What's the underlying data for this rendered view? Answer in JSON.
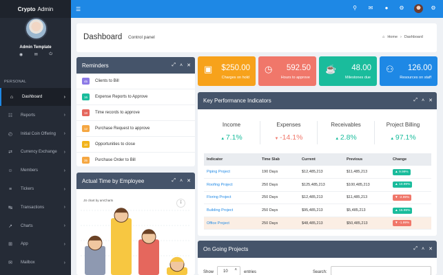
{
  "app": {
    "brand_bold": "Crypto",
    "brand_light": "Admin"
  },
  "user": {
    "name": "Admin Template",
    "icons": [
      "user-icon",
      "mail-icon",
      "power-icon"
    ]
  },
  "sidebar": {
    "section": "PERSONAL",
    "items": [
      {
        "label": "Dashboard",
        "icon": "home-icon",
        "active": true
      },
      {
        "label": "Reports",
        "icon": "reports-icon"
      },
      {
        "label": "Initial Coin Offering",
        "icon": "clock-icon"
      },
      {
        "label": "Currency Exchange",
        "icon": "exchange-icon"
      },
      {
        "label": "Members",
        "icon": "members-icon"
      },
      {
        "label": "Tickers",
        "icon": "sliders-icon"
      },
      {
        "label": "Transactions",
        "icon": "transactions-icon"
      },
      {
        "label": "Charts",
        "icon": "chart-icon"
      },
      {
        "label": "App",
        "icon": "grid-icon"
      },
      {
        "label": "Mailbox",
        "icon": "mailbox-icon"
      }
    ]
  },
  "header": {
    "title": "Dashboard",
    "subtitle": "Control panel",
    "breadcrumb_home": "Home",
    "breadcrumb_current": "Dashboard"
  },
  "reminders": {
    "title": "Reminders",
    "items": [
      {
        "badge": "45",
        "color": "#8c7ae6",
        "label": "Clients to Bill"
      },
      {
        "badge": "16",
        "color": "#1abc9c",
        "label": "Expense Reports to Approve"
      },
      {
        "badge": "18",
        "color": "#e5675d",
        "label": "Time records to approve"
      },
      {
        "badge": "12",
        "color": "#f5a742",
        "label": "Purchase Request to approve"
      },
      {
        "badge": "10",
        "color": "#f2b31a",
        "label": "Opportunities to close"
      },
      {
        "badge": "35",
        "color": "#f5a742",
        "label": "Purchase Order to Bill"
      }
    ]
  },
  "stats": [
    {
      "value": "$250.00",
      "label": "Charges on hold",
      "color": "#f7a21b",
      "icon": "money-icon"
    },
    {
      "value": "592.50",
      "label": "Hours to approve",
      "color": "#f0776a",
      "icon": "clock-icon"
    },
    {
      "value": "48.00",
      "label": "Milestones due",
      "color": "#1abc9c",
      "icon": "trophy-icon"
    },
    {
      "value": "126.00",
      "label": "Resources on staff",
      "color": "#1e88e5",
      "icon": "users-icon"
    }
  ],
  "kpi": {
    "title": "Key Performance Indicators",
    "blocks": [
      {
        "name": "Income",
        "value": "7.1%",
        "dir": "up"
      },
      {
        "name": "Expenses",
        "value": "-14.1%",
        "dir": "down"
      },
      {
        "name": "Receivables",
        "value": "2.8%",
        "dir": "up"
      },
      {
        "name": "Project Billing",
        "value": "97.1%",
        "dir": "up"
      }
    ],
    "columns": [
      "Indicator",
      "Time Slab",
      "Current",
      "Previous",
      "Change"
    ],
    "rows": [
      {
        "indicator": "Piping Project",
        "slab": "190 Days",
        "current": "$12,485,213",
        "previous": "$11,485,213",
        "change": "9.99%",
        "dir": "up"
      },
      {
        "indicator": "Roofing Project",
        "slab": "250 Days",
        "current": "$125,485,213",
        "previous": "$100,485,213",
        "change": "10.99%",
        "dir": "up"
      },
      {
        "indicator": "Floring Project",
        "slab": "250 Days",
        "current": "$12,485,213",
        "previous": "$11,485,213",
        "change": "-2.99%",
        "dir": "down"
      },
      {
        "indicator": "Building Project",
        "slab": "250 Days",
        "current": "$95,485,213",
        "previous": "$5,485,213",
        "change": "15.99%",
        "dir": "up"
      },
      {
        "indicator": "Office Project",
        "slab": "250 Days",
        "current": "$48,485,213",
        "previous": "$50,485,213",
        "change": "-1.99%",
        "dir": "down"
      }
    ]
  },
  "chart_panel": {
    "title": "Actual Time by Employee",
    "credit": "JS chart by amCharts"
  },
  "chart_data": {
    "type": "bar",
    "categories": [
      "",
      "",
      "",
      ""
    ],
    "values": [
      45,
      88,
      55,
      12
    ],
    "colors": [
      "#8e99b1",
      "#f7c741",
      "#e5675d",
      "#f7c741"
    ],
    "ylim": [
      0,
      100
    ]
  },
  "ongoing": {
    "title": "On Going Projects",
    "show_label": "Show",
    "entries_value": "10",
    "entries_label": "entries",
    "search_label": "Search:"
  },
  "colors": {
    "primary": "#1e88e5",
    "sidebar": "#252b36",
    "panel_head": "#45546a",
    "up": "#1abc9c",
    "down": "#f0776a"
  }
}
